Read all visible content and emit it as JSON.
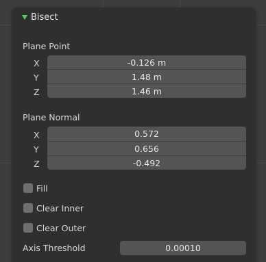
{
  "panel": {
    "title": "Bisect",
    "header_icon": "expanded-triangle-icon",
    "accent_color": "#4dcf5f"
  },
  "plane_point": {
    "label": "Plane Point",
    "x_label": "X",
    "y_label": "Y",
    "z_label": "Z",
    "x_value": "-0.126 m",
    "y_value": "1.48 m",
    "z_value": "1.46 m"
  },
  "plane_normal": {
    "label": "Plane Normal",
    "x_label": "X",
    "y_label": "Y",
    "z_label": "Z",
    "x_value": "0.572",
    "y_value": "0.656",
    "z_value": "-0.492"
  },
  "options": {
    "fill_label": "Fill",
    "fill_checked": false,
    "clear_inner_label": "Clear Inner",
    "clear_inner_checked": false,
    "clear_outer_label": "Clear Outer",
    "clear_outer_checked": false
  },
  "axis_threshold": {
    "label": "Axis Threshold",
    "value": "0.00010"
  }
}
